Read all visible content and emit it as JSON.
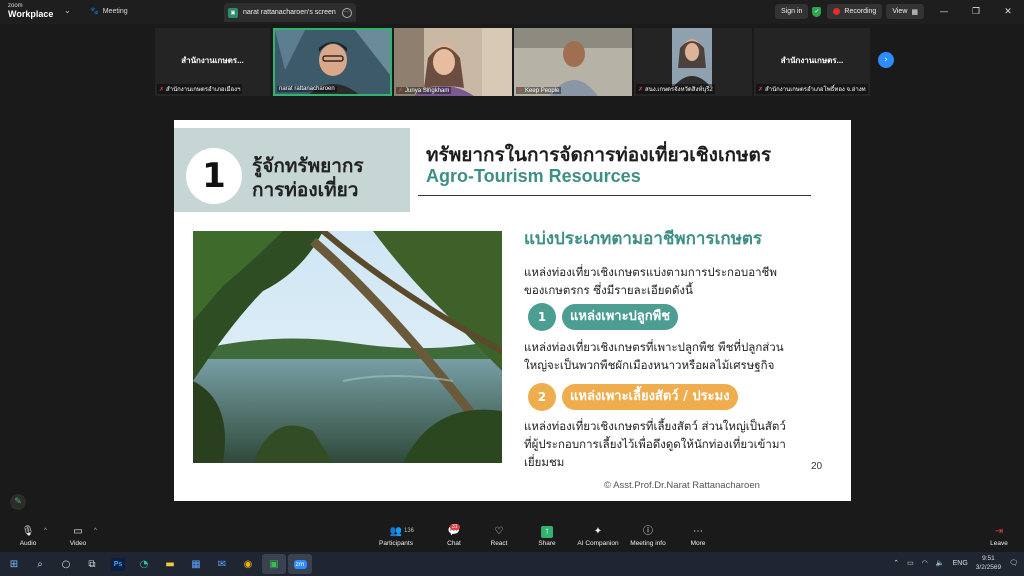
{
  "titlebar": {
    "logo_top": "zoom",
    "logo_bottom": "Workplace",
    "meeting_label": "Meeting",
    "tab_title": "narat rattanacharoen's screen",
    "sign_in": "Sign in",
    "recording": "Recording",
    "view": "View"
  },
  "participants": [
    {
      "big_label": "สำนักงานเกษตร...",
      "name": "สำนักงานเกษตรอำเภอเมืองฯ"
    },
    {
      "big_label": "",
      "name": "narat rattanacharoen"
    },
    {
      "big_label": "",
      "name": "Junya Singkham"
    },
    {
      "big_label": "",
      "name": "Keep People"
    },
    {
      "big_label": "",
      "name": "สนง.เกษตรจังหวัดสิงห์บุรี2"
    },
    {
      "big_label": "สำนักงานเกษตร...",
      "name": "สำนักงานเกษตรอำเภอโพธิ์ทอง จ.อ่างท"
    }
  ],
  "slide": {
    "number": "1",
    "header_thai_line1": "รู้จักทรัพยากร",
    "header_thai_line2": "การท่องเที่ยว",
    "title_thai": "ทรัพยากรในการจัดการท่องเที่ยวเชิงเกษตร",
    "title_english": "Agro-Tourism Resources",
    "subheading": "แบ่งประเภทตามอาชีพการเกษตร",
    "intro_line1": "แหล่งท่องเที่ยวเชิงเกษตรแบ่งตามการประกอบอาชีพ",
    "intro_line2": "ของเกษตรกร ซึ่งมีรายละเอียดดังนี้",
    "item1_num": "1",
    "item1_label": "แหล่งเพาะปลูกพืช",
    "item1_line1": "แหล่งท่องเที่ยวเชิงเกษตรที่เพาะปลูกพืช พืชที่ปลูกส่วน",
    "item1_line2": "ใหญ่จะเป็นพวกพืชผักเมืองหนาวหรือผลไม้เศรษฐกิจ",
    "item2_num": "2",
    "item2_label": "แหล่งเพาะเลี้ยงสัตว์ / ประมง",
    "item2_line1": "แหล่งท่องเที่ยวเชิงเกษตรที่เลี้ยงสัตว์ ส่วนใหญ่เป็นสัตว์",
    "item2_line2": "ที่ผู้ประกอบการเลี้ยงไว้เพื่อดึงดูดให้นักท่องเที่ยวเข้ามา",
    "item2_line3": "เยี่ยมชม",
    "page_number": "20",
    "copyright": "© Asst.Prof.Dr.Narat Rattanacharoen"
  },
  "toolbar": {
    "audio": "Audio",
    "video": "Video",
    "participants": "Participants",
    "participants_count": "136",
    "chat": "Chat",
    "chat_badge": "31",
    "react": "React",
    "share": "Share",
    "ai_companion": "AI Companion",
    "meeting_info": "Meeting info",
    "more": "More",
    "leave": "Leave"
  },
  "taskbar": {
    "lang": "ENG",
    "time": "9:51",
    "date": "3/2/2569",
    "app_zoom": "zm"
  },
  "colors": {
    "accent_teal": "#3e8f86",
    "badge_green": "#4c9d92",
    "badge_orange": "#f0ad4e",
    "header_box": "#c5d6d4",
    "recording_red": "#e02d2d"
  }
}
